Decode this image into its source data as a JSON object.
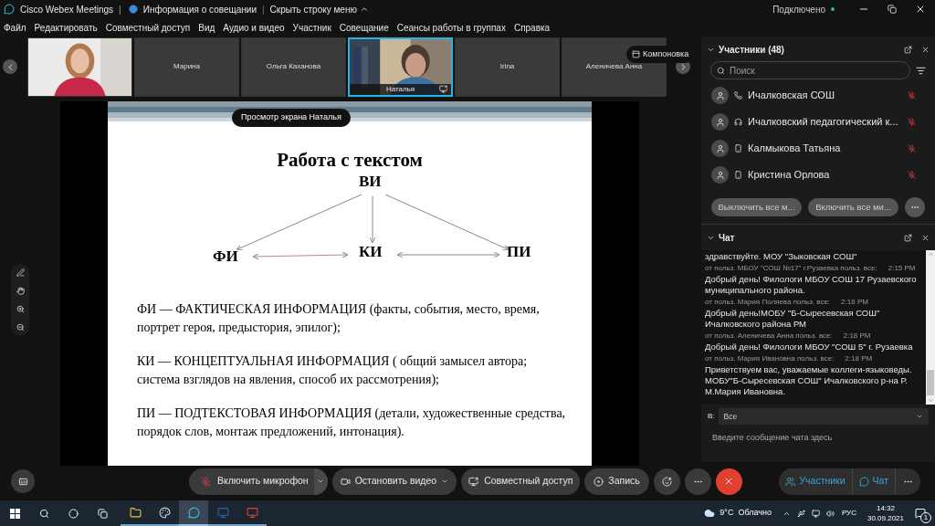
{
  "title_bar": {
    "app": "Cisco Webex Meetings",
    "separator": "|",
    "meeting_info": "Информация о совещании",
    "separator_2": "|",
    "hide_menu": "Скрыть строку меню",
    "status": "Подключено"
  },
  "menu": [
    "Файл",
    "Редактировать",
    "Совместный доступ",
    "Вид",
    "Аудио и видео",
    "Участник",
    "Совещание",
    "Сеансы работы в группах",
    "Справка"
  ],
  "video_tiles": [
    {
      "kind": "picture",
      "selected": false
    },
    {
      "kind": "name",
      "name": "Марина",
      "selected": false
    },
    {
      "kind": "name",
      "name": "Ольга Каханова",
      "selected": false
    },
    {
      "kind": "picture",
      "name": "Наталья",
      "selected": true
    },
    {
      "kind": "name",
      "name": "Irina",
      "selected": false
    },
    {
      "kind": "name",
      "name": "Аленичева Анна",
      "selected": false
    }
  ],
  "layout_button": "Компоновка",
  "share_badge": "Просмотр экрана Наталья",
  "slide": {
    "title": "Работа с текстом",
    "nodes": [
      "ВИ",
      "ФИ",
      "КИ",
      "ПИ"
    ],
    "paragraphs": [
      "ФИ — ФАКТИЧЕСКАЯ ИНФОРМАЦИЯ (факты, события, место, время, портрет героя, предыстория, эпилог);",
      "КИ — КОНЦЕПТУАЛЬНАЯ ИНФОРМАЦИЯ ( общий замысел автора; система взглядов на явления, способ их рассмотрения);",
      "ПИ — ПОДТЕКСТОВАЯ ИНФОРМАЦИЯ (детали, художественные средства, порядок слов, монтаж предложений, интонация)."
    ]
  },
  "participants": {
    "title": "Участники (48)",
    "search_placeholder": "Поиск",
    "items": [
      {
        "name": "Ичалковская СОШ",
        "kind": "phone",
        "muted": true
      },
      {
        "name": "Ичалковский педагогический к...",
        "kind": "headset",
        "muted": true
      },
      {
        "name": "Калмыкова Татьяна",
        "kind": "mobile",
        "muted": true
      },
      {
        "name": "Кристина Орлова",
        "kind": "mobile",
        "muted": true
      }
    ],
    "buttons": [
      "Выключить все м...",
      "Включить все ми..."
    ]
  },
  "chat": {
    "title": "Чат",
    "messages": [
      {
        "text": "здравствуйте. МОУ \"Зыковская СОШ\""
      },
      {
        "from": "от польз. МБОУ \"СОШ №17\" г.Рузаевка польз. все:",
        "time": "2:15 PM",
        "text": "Добрый день! Филологи МБОУ СОШ 17 Рузаевского муниципального района."
      },
      {
        "from": "от польз. Мария Поляева польз. все:",
        "time": "2:16 PM",
        "text": "Добрый день!МОБУ \"Б-Сыресевская СОШ\" Ичалковского района РМ"
      },
      {
        "from": "от польз. Аленичева Анна польз. все:",
        "time": "2:18 PM",
        "text": "Добрый день! Филологи МБОУ \"СОШ 5\" г. Рузаевка"
      },
      {
        "from": "от польз. Мария Ивановна польз. все:",
        "time": "2:18 PM",
        "text": "Приветствуем вас, уважаемые коллеги-языковеды. МОБУ\"Б-Сыресевская СОШ\" Ичалковского р-на Р. М.Мария Ивановна."
      }
    ],
    "to_label": "В:",
    "to_value": "Все",
    "input_placeholder": "Введите сообщение чата здесь"
  },
  "toolbar": {
    "mic": {
      "label": "Включить микрофон",
      "muted": true
    },
    "video": "Остановить видео",
    "share": "Совместный доступ",
    "record": "Запись",
    "tabs": [
      {
        "label": "Участники",
        "selected": true
      },
      {
        "label": "Чат",
        "selected": true
      }
    ]
  },
  "taskbar": {
    "apps": [
      {
        "kind": "folder",
        "active": false
      },
      {
        "kind": "paint",
        "active": false
      },
      {
        "kind": "webex",
        "active": true
      },
      {
        "kind": "word",
        "active": false
      },
      {
        "kind": "powerpoint",
        "active": false
      }
    ],
    "weather": "9°C  Облачно",
    "language": "РУС",
    "time": "14:32",
    "date": "30.09.2021",
    "notifications": "1"
  }
}
